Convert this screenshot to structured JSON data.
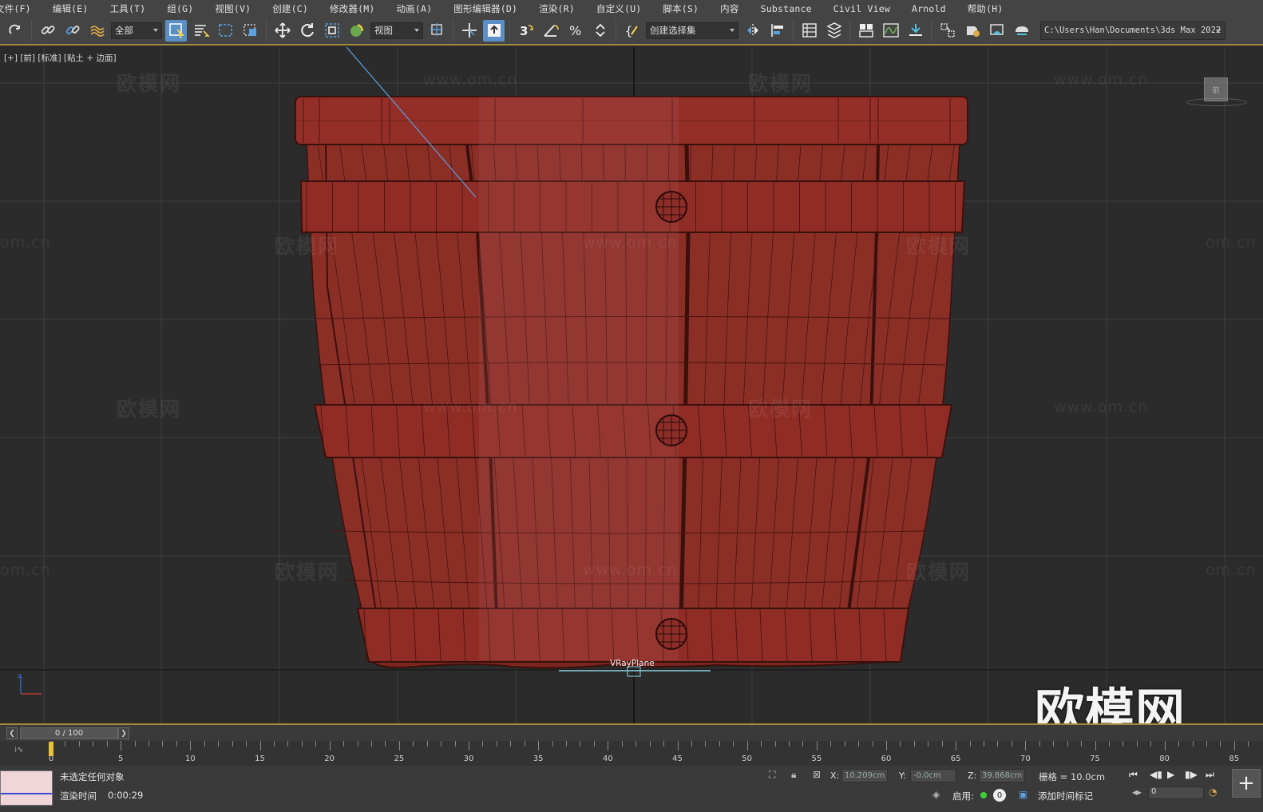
{
  "menu": [
    "文件(F)",
    "编辑(E)",
    "工具(T)",
    "组(G)",
    "视图(V)",
    "创建(C)",
    "修改器(M)",
    "动画(A)",
    "图形编辑器(D)",
    "渲染(R)",
    "自定义(U)",
    "脚本(S)",
    "内容",
    "Substance",
    "Civil View",
    "Arnold",
    "帮助(H)"
  ],
  "toolbar": {
    "filter_value": "全部",
    "ref_coord_value": "视图",
    "selection_set_placeholder": "创建选择集",
    "project_path": "C:\\Users\\Han\\Documents\\3ds Max 2022"
  },
  "viewport": {
    "label": "[+] [前] [标准] [粘土 + 边面]",
    "object_label": "VRayPlane",
    "viewcube_label": "前",
    "watermark_cn": "欧模网",
    "watermark_url": "www.om.cn",
    "watermark_url_partial": "om.cn",
    "brand_watermark": "欧模网",
    "colors": {
      "background": "#2b2b2b",
      "grid": "#3f3f3f",
      "barrel": "#8a2e26",
      "barrel_dark": "#4a1410",
      "selection_line": "#5aa0e0"
    }
  },
  "timeline": {
    "frame_display": "0 / 100",
    "ticks": [
      0,
      5,
      10,
      15,
      20,
      25,
      30,
      35,
      40,
      45,
      50,
      55,
      60,
      65,
      70,
      75,
      80,
      85
    ],
    "range_end": 100
  },
  "status": {
    "selection_text": "未选定任何对象",
    "render_time_label": "渲染时间",
    "render_time_value": "0:00:29",
    "x_label": "X:",
    "x_value": "10.209cm",
    "y_label": "Y:",
    "y_value": "-0.0cm",
    "z_label": "Z:",
    "z_value": "39.868cm",
    "grid_text": "栅格 = 10.0cm",
    "enable_label": "启用:",
    "enable_count": "0",
    "add_time_tag": "添加时间标记",
    "current_frame": "0"
  }
}
